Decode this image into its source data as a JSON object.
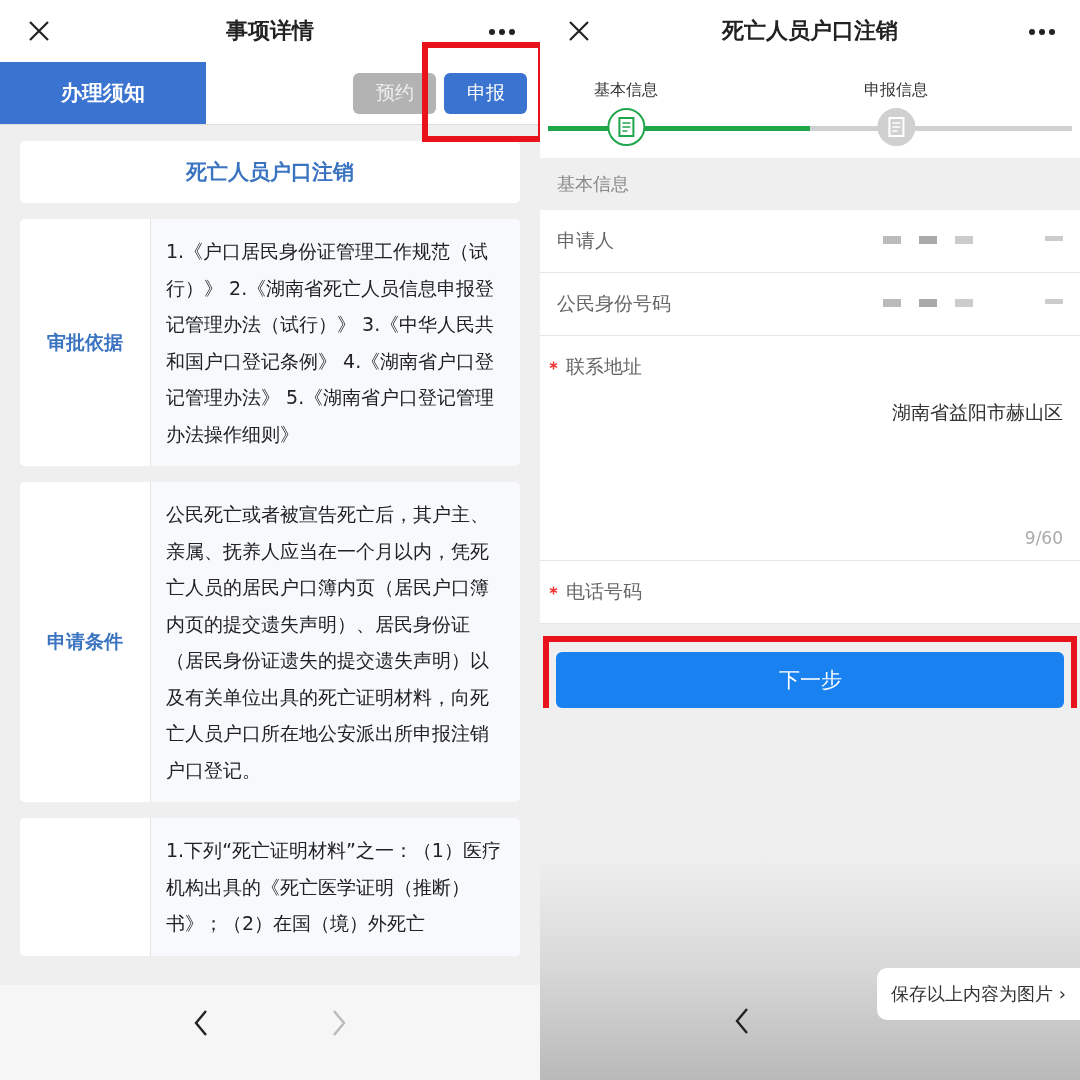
{
  "left": {
    "title": "事项详情",
    "tabs": [
      {
        "label": "办理须知",
        "selected": true
      }
    ],
    "actions": [
      {
        "label": "预约",
        "disabled": true,
        "highlighted": false
      },
      {
        "label": "申报",
        "disabled": false,
        "highlighted": true
      }
    ],
    "item_title": "死亡人员户口注销",
    "sections": [
      {
        "label": "审批依据",
        "text": "1.《户口居民身份证管理工作规范（试行）》 2.《湖南省死亡人员信息申报登记管理办法（试行）》 3.《中华人民共和国户口登记条例》 4.《湖南省户口登记管理办法》 5.《湖南省户口登记管理办法操作细则》"
      },
      {
        "label": "申请条件",
        "text": "公民死亡或者被宣告死亡后，其户主、亲属、抚养人应当在一个月以内，凭死亡人员的居民户口簿内页（居民户口簿内页的提交遗失声明）、居民身份证（居民身份证遗失的提交遗失声明）以及有关单位出具的死亡证明材料，向死亡人员户口所在地公安派出所申报注销户口登记。"
      },
      {
        "text": "1.下列“死亡证明材料”之一：（1）医疗机构出具的《死亡医学证明（推断）书》；（2）在国（境）外死亡"
      }
    ],
    "nav": {
      "back_disabled": false,
      "forward_disabled": true
    }
  },
  "right": {
    "title": "死亡人员户口注销",
    "steps": [
      {
        "label": "基本信息",
        "active": true
      },
      {
        "label": "申报信息",
        "active": false
      }
    ],
    "section": "基本信息",
    "fields": [
      {
        "kind": "readonly",
        "label": "申请人",
        "required": false
      },
      {
        "kind": "readonly",
        "label": "公民身份号码",
        "required": false
      },
      {
        "kind": "textarea",
        "label": "联系地址",
        "required": true,
        "value": "湖南省益阳市赫山区",
        "counter": "9/60"
      },
      {
        "kind": "input",
        "label": "电话号码",
        "required": true
      }
    ],
    "submit": {
      "label": "下一步",
      "highlighted": true
    },
    "save_popup": "保存以上内容为图片 ›"
  }
}
